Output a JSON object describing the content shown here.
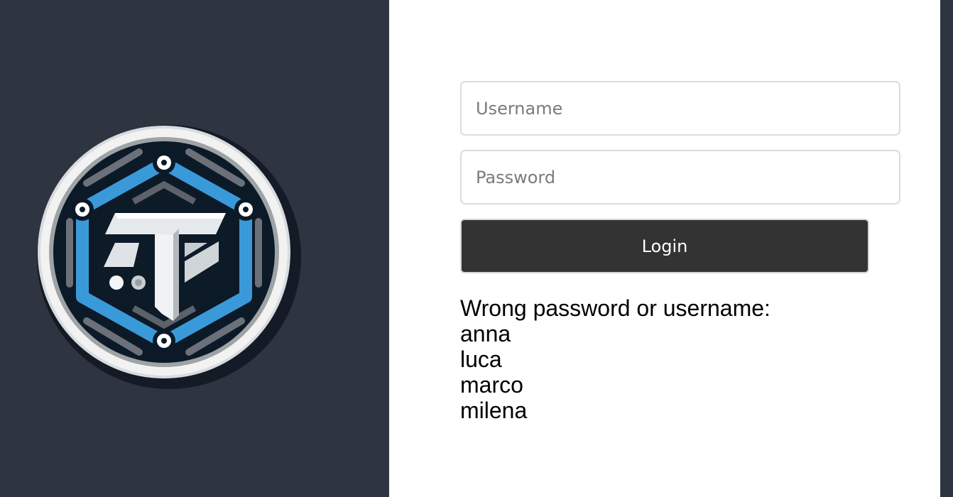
{
  "form": {
    "username_placeholder": "Username",
    "password_placeholder": "Password",
    "login_label": "Login"
  },
  "error": {
    "heading": "Wrong password or username:",
    "users": [
      "anna",
      "luca",
      "marco",
      "milena"
    ]
  },
  "colors": {
    "background": "#2e3440",
    "panel": "#ffffff",
    "button": "#333333",
    "logo_blue": "#3a9ad9"
  }
}
